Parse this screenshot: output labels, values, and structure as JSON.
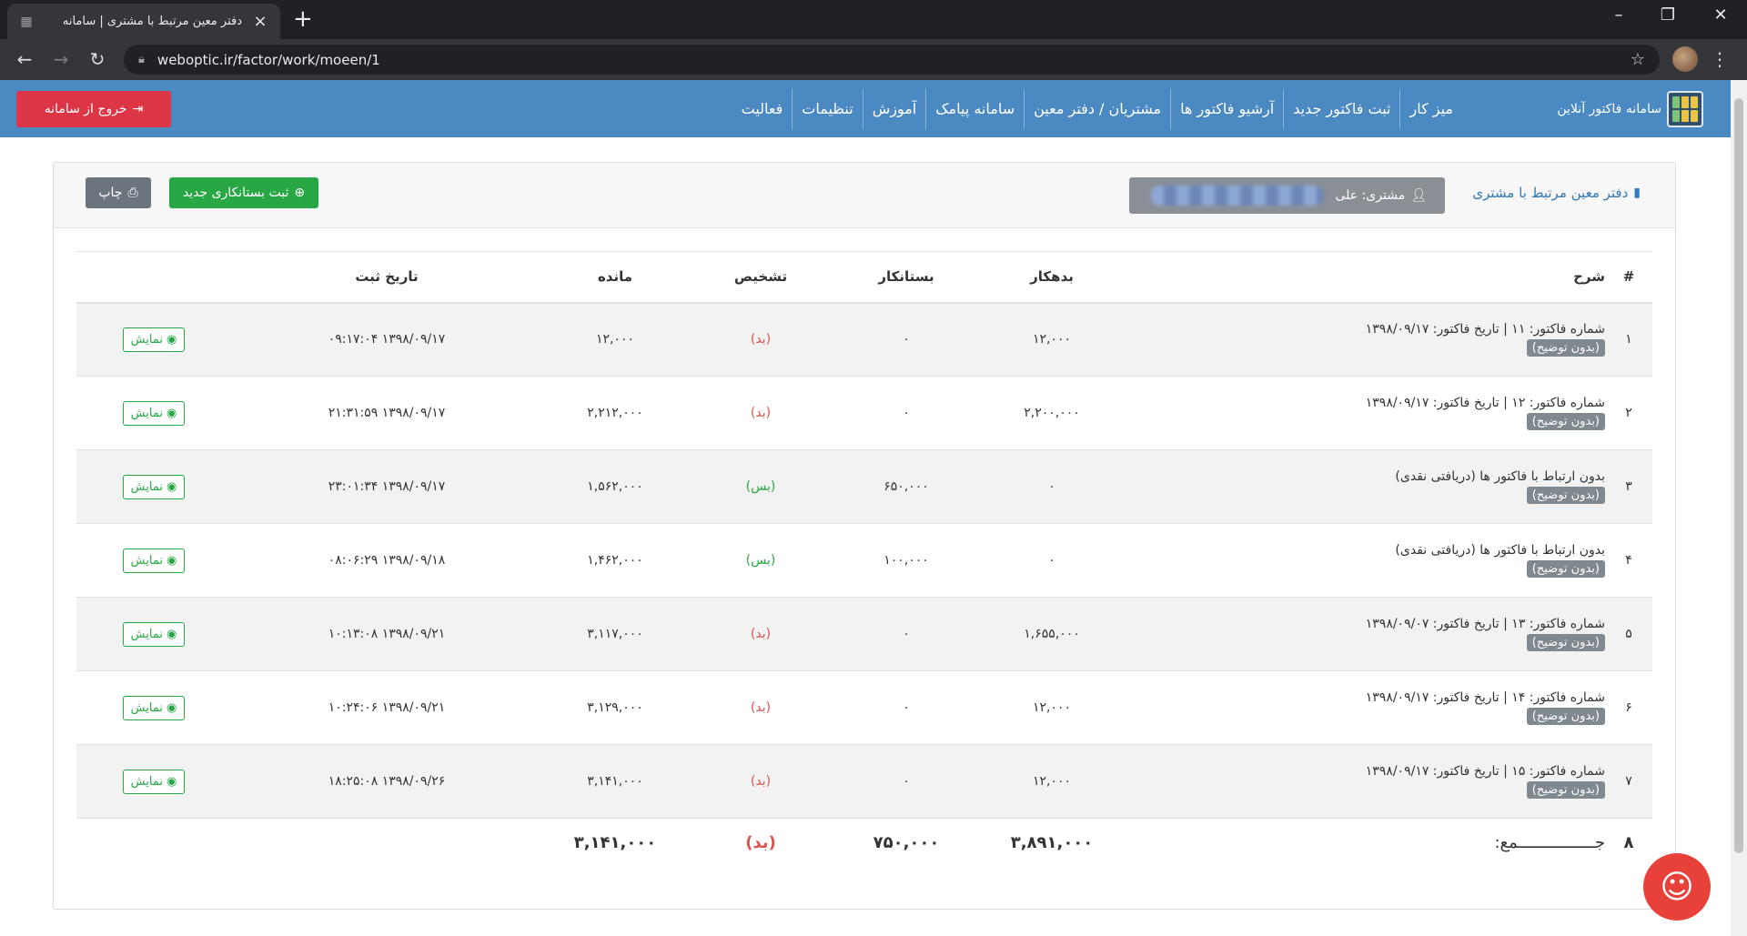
{
  "browser": {
    "tab_title": "دفتر معین مرتبط با مشتری | سامانه",
    "url": "weboptic.ir/factor/work/moeen/1"
  },
  "navbar": {
    "brand": "سامانه فاکتور آنلاین",
    "links": [
      "میز کار",
      "ثبت فاکتور جدید",
      "آرشیو فاکتور ها",
      "مشتریان / دفتر معین",
      "سامانه پیامک",
      "آموزش",
      "تنظیمات",
      "فعالیت"
    ],
    "logout": "خروج از سامانه"
  },
  "card": {
    "title": "دفتر معین مرتبط با مشتری",
    "customer_label": "مشتری: علی",
    "new_credit_button": "ثبت بستانکاری جدید",
    "print_button": "چاپ"
  },
  "table": {
    "headers": {
      "idx": "#",
      "desc": "شرح",
      "debit": "بدهکار",
      "credit": "بستانکار",
      "status": "تشخیص",
      "balance": "مانده",
      "date": "تاریخ ثبت"
    },
    "badge_text": "(بدون توضیح)",
    "show_label": "نمایش",
    "rows": [
      {
        "idx": "۱",
        "desc": "شماره فاکتور: ۱۱ | تاریخ فاکتور: ۱۳۹۸/۰۹/۱۷",
        "debit": "۱۲,۰۰۰",
        "credit": "۰",
        "status": "(بد)",
        "balance": "۱۲,۰۰۰",
        "date": "۱۳۹۸/۰۹/۱۷ ۰۹:۱۷:۰۴"
      },
      {
        "idx": "۲",
        "desc": "شماره فاکتور: ۱۲ | تاریخ فاکتور: ۱۳۹۸/۰۹/۱۷",
        "debit": "۲,۲۰۰,۰۰۰",
        "credit": "۰",
        "status": "(بد)",
        "balance": "۲,۲۱۲,۰۰۰",
        "date": "۱۳۹۸/۰۹/۱۷ ۲۱:۳۱:۵۹"
      },
      {
        "idx": "۳",
        "desc": "بدون ارتباط با فاکتور ها (دریافتی نقدی)",
        "debit": "۰",
        "credit": "۶۵۰,۰۰۰",
        "status": "(بس)",
        "balance": "۱,۵۶۲,۰۰۰",
        "date": "۱۳۹۸/۰۹/۱۷ ۲۳:۰۱:۳۴"
      },
      {
        "idx": "۴",
        "desc": "بدون ارتباط با فاکتور ها (دریافتی نقدی)",
        "debit": "۰",
        "credit": "۱۰۰,۰۰۰",
        "status": "(بس)",
        "balance": "۱,۴۶۲,۰۰۰",
        "date": "۱۳۹۸/۰۹/۱۸ ۰۸:۰۶:۲۹"
      },
      {
        "idx": "۵",
        "desc": "شماره فاکتور: ۱۳ | تاریخ فاکتور: ۱۳۹۸/۰۹/۰۷",
        "debit": "۱,۶۵۵,۰۰۰",
        "credit": "۰",
        "status": "(بد)",
        "balance": "۳,۱۱۷,۰۰۰",
        "date": "۱۳۹۸/۰۹/۲۱ ۱۰:۱۳:۰۸"
      },
      {
        "idx": "۶",
        "desc": "شماره فاکتور: ۱۴ | تاریخ فاکتور: ۱۳۹۸/۰۹/۱۷",
        "debit": "۱۲,۰۰۰",
        "credit": "۰",
        "status": "(بد)",
        "balance": "۳,۱۲۹,۰۰۰",
        "date": "۱۳۹۸/۰۹/۲۱ ۱۰:۲۴:۰۶"
      },
      {
        "idx": "۷",
        "desc": "شماره فاکتور: ۱۵ | تاریخ فاکتور: ۱۳۹۸/۰۹/۱۷",
        "debit": "۱۲,۰۰۰",
        "credit": "۰",
        "status": "(بد)",
        "balance": "۳,۱۴۱,۰۰۰",
        "date": "۱۳۹۸/۰۹/۲۶ ۱۸:۲۵:۰۸"
      }
    ],
    "total": {
      "idx": "۸",
      "label": "جــــــــــــــــمع:",
      "debit": "۳,۸۹۱,۰۰۰",
      "credit": "۷۵۰,۰۰۰",
      "status": "(بد)",
      "balance": "۳,۱۴۱,۰۰۰"
    }
  },
  "colors": {
    "navbar": "#4a89c2",
    "logout": "#dc3545",
    "green": "#28a745",
    "debit_status": "#d9534f",
    "credit_status": "#28a745",
    "chat": "#e8413a"
  }
}
